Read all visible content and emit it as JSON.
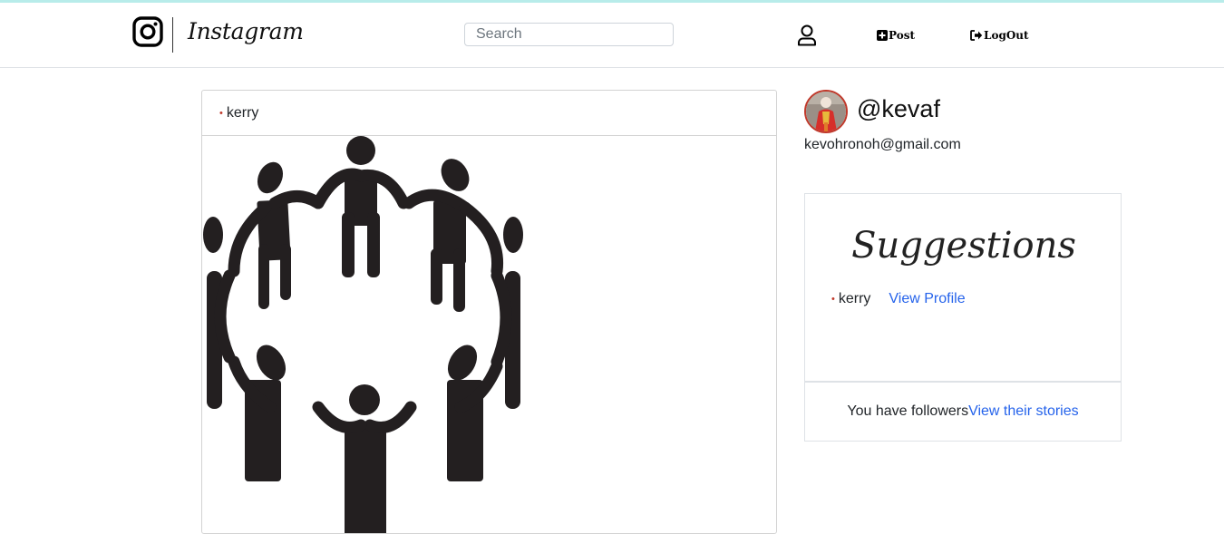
{
  "navbar": {
    "brand": "Instagram",
    "search_placeholder": "Search",
    "post_label": "Post",
    "logout_label": "LogOut"
  },
  "post": {
    "author": "kerry"
  },
  "profile": {
    "username": "@kevaf",
    "email": "kevohronoh@gmail.com"
  },
  "suggestions": {
    "title": "Suggestions",
    "items": [
      {
        "name": "kerry",
        "action": "View Profile"
      }
    ]
  },
  "followers": {
    "text": "You have followers",
    "link": "View their stories"
  },
  "colors": {
    "link": "#2563eb",
    "accent_red": "#c0392b",
    "top_accent": "#b8ecea"
  }
}
